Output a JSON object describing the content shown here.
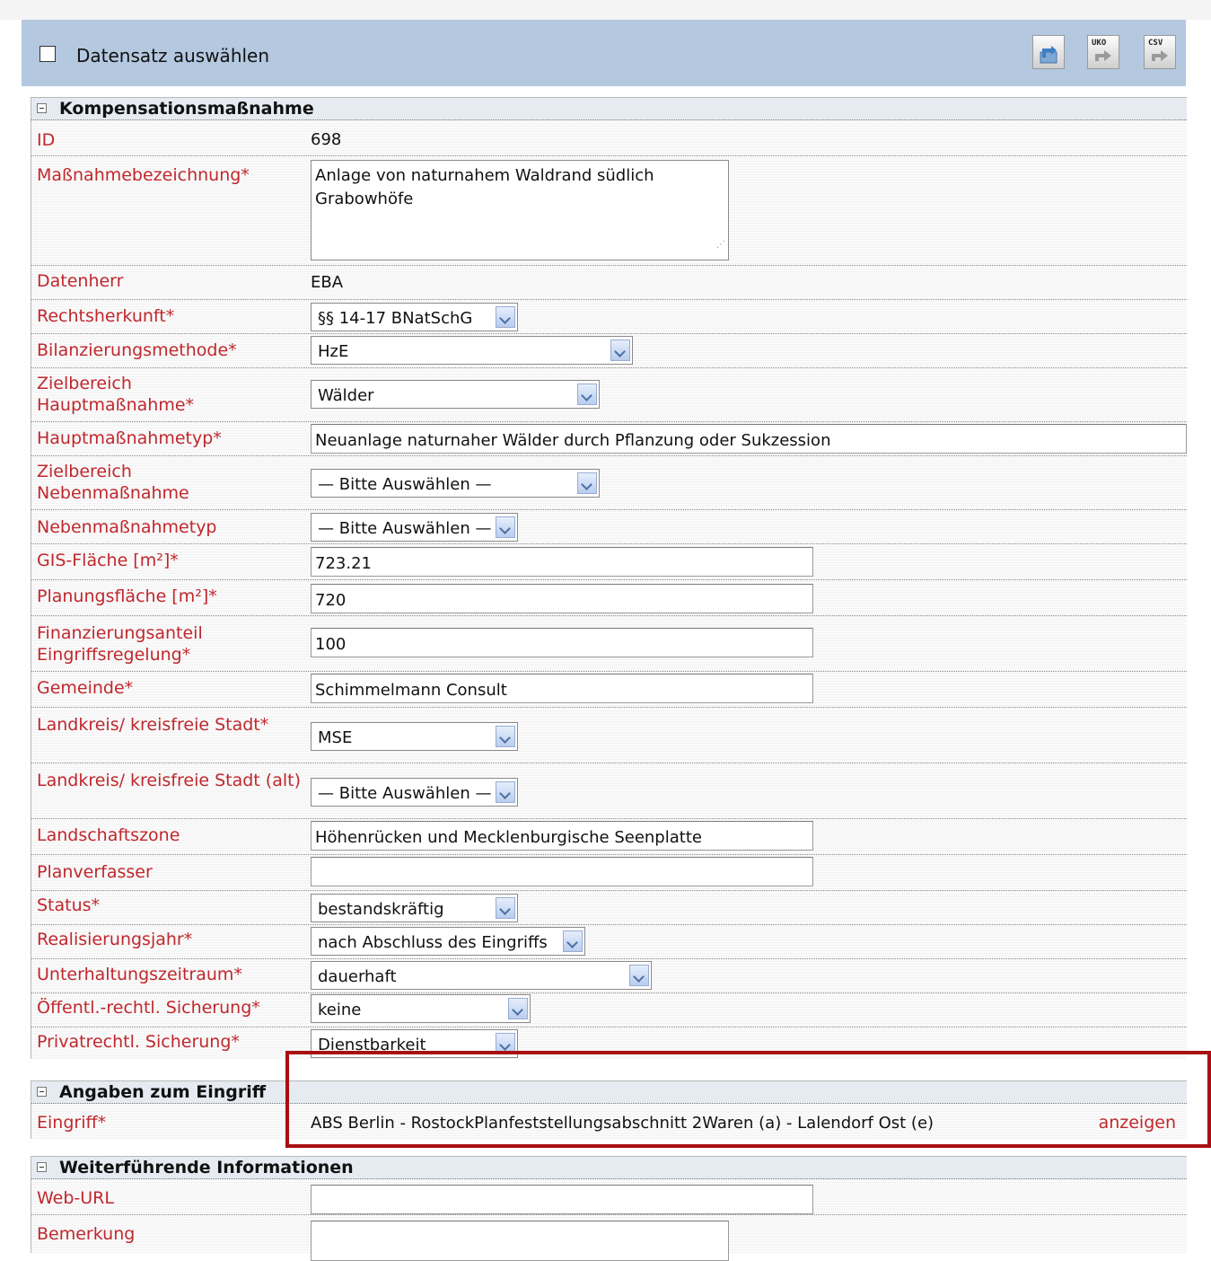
{
  "header": {
    "select_record_label": "Datensatz auswählen",
    "buttons": [
      {
        "tag": ""
      },
      {
        "tag": "UKO"
      },
      {
        "tag": "CSV"
      }
    ]
  },
  "section1": {
    "title": "Kompensationsmaßnahme",
    "id_label": "ID",
    "id_value": "698",
    "name_label": "Maßnahmebezeichnung*",
    "name_value": "Anlage von naturnahem Waldrand südlich Grabowhöfe",
    "owner_label": "Datenherr",
    "owner_value": "EBA",
    "legal_label": "Rechtsherkunft*",
    "legal_value": "§§ 14-17 BNatSchG",
    "method_label": "Bilanzierungsmethode*",
    "method_value": "HzE",
    "zone_main_label": "Zielbereich Hauptmaßnahme*",
    "zone_main_value": "Wälder",
    "type_main_label": "Hauptmaßnahmetyp*",
    "type_main_value": "Neuanlage naturnaher Wälder durch Pflanzung oder Sukzession",
    "zone_side_label": "Zielbereich Nebenmaßnahme",
    "zone_side_value": "— Bitte Auswählen —",
    "type_side_label": "Nebenmaßnahmetyp",
    "type_side_value": "— Bitte Auswählen —",
    "gis_label": "GIS-Fläche [m²]*",
    "gis_value": "723.21",
    "plan_area_label": "Planungsfläche [m²]*",
    "plan_area_value": "720",
    "funding_label": "Finanzierungsanteil Eingriffsregelung*",
    "funding_value": "100",
    "municipality_label": "Gemeinde*",
    "municipality_value": "Schimmelmann Consult",
    "district_label": "Landkreis/ kreisfreie Stadt*",
    "district_value": "MSE",
    "district_old_label": "Landkreis/ kreisfreie Stadt (alt)",
    "district_old_value": "— Bitte Auswählen —",
    "landscape_label": "Landschaftszone",
    "landscape_value": "Höhenrücken und Mecklenburgische Seenplatte",
    "planner_label": "Planverfasser",
    "planner_value": "",
    "status_label": "Status*",
    "status_value": "bestandskräftig",
    "year_label": "Realisierungsjahr*",
    "year_value": "nach Abschluss des Eingriffs",
    "maint_label": "Unterhaltungszeitraum*",
    "maint_value": "dauerhaft",
    "public_label": "Öffentl.-rechtl. Sicherung*",
    "public_value": "keine",
    "private_label": "Privatrechtl. Sicherung*",
    "private_value": "Dienstbarkeit"
  },
  "section2": {
    "title": "Angaben zum Eingriff",
    "intervention_label": "Eingriff*",
    "intervention_value": "ABS Berlin - RostockPlanfeststellungsabschnitt 2Waren (a) - Lalendorf Ost (e)",
    "show_link": "anzeigen"
  },
  "section3": {
    "title": "Weiterführende Informationen",
    "url_label": "Web-URL",
    "url_value": "",
    "remark_label": "Bemerkung",
    "remark_value": ""
  },
  "colors": {
    "label_red": "#c0272d",
    "header_blue": "#b4c8e0",
    "highlight_box": "#a80f13"
  },
  "icons": [
    "checkbox",
    "import-icon",
    "export-uko-icon",
    "export-csv-icon",
    "collapse-icon",
    "dropdown-arrow-icon"
  ]
}
